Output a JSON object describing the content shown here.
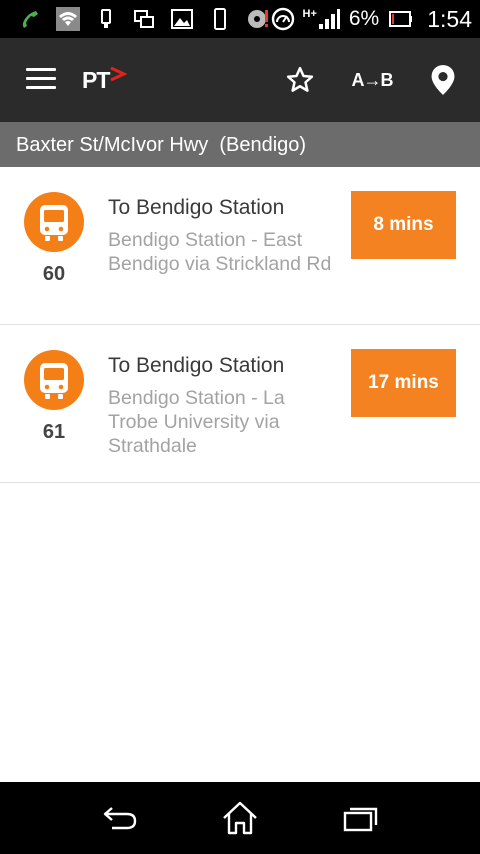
{
  "status_bar": {
    "battery_percent": "6%",
    "time": "1:54",
    "network_label": "H+",
    "icons": [
      "phone-call-icon",
      "wifi-icon",
      "usb-debug-icon",
      "screen-mirror-icon",
      "image-icon",
      "device-icon",
      "storage-alert-icon",
      "speedometer-icon",
      "signal-icon",
      "battery-icon"
    ]
  },
  "app_bar": {
    "logo_text": "PT",
    "ab_label": "A→B",
    "icons": [
      "menu-icon",
      "favorite-star-icon",
      "location-pin-icon"
    ]
  },
  "stop": {
    "title": "Baxter St/McIvor Hwy  (Bendigo)"
  },
  "departures": [
    {
      "route": "60",
      "destination": "To Bendigo Station",
      "description": "Bendigo Station - East Bendigo via Strickland Rd",
      "time": "8 mins"
    },
    {
      "route": "61",
      "destination": "To Bendigo Station",
      "description": "Bendigo Station - La Trobe University via Strathdale",
      "time": "17 mins"
    }
  ],
  "nav_bar": {
    "icons": [
      "back-icon",
      "home-icon",
      "recent-apps-icon"
    ]
  },
  "colors": {
    "accent": "#f58220",
    "app_bar": "#2b2b2b",
    "stop_bar": "#6c6c6c",
    "logo_arrow": "#e2231a"
  }
}
